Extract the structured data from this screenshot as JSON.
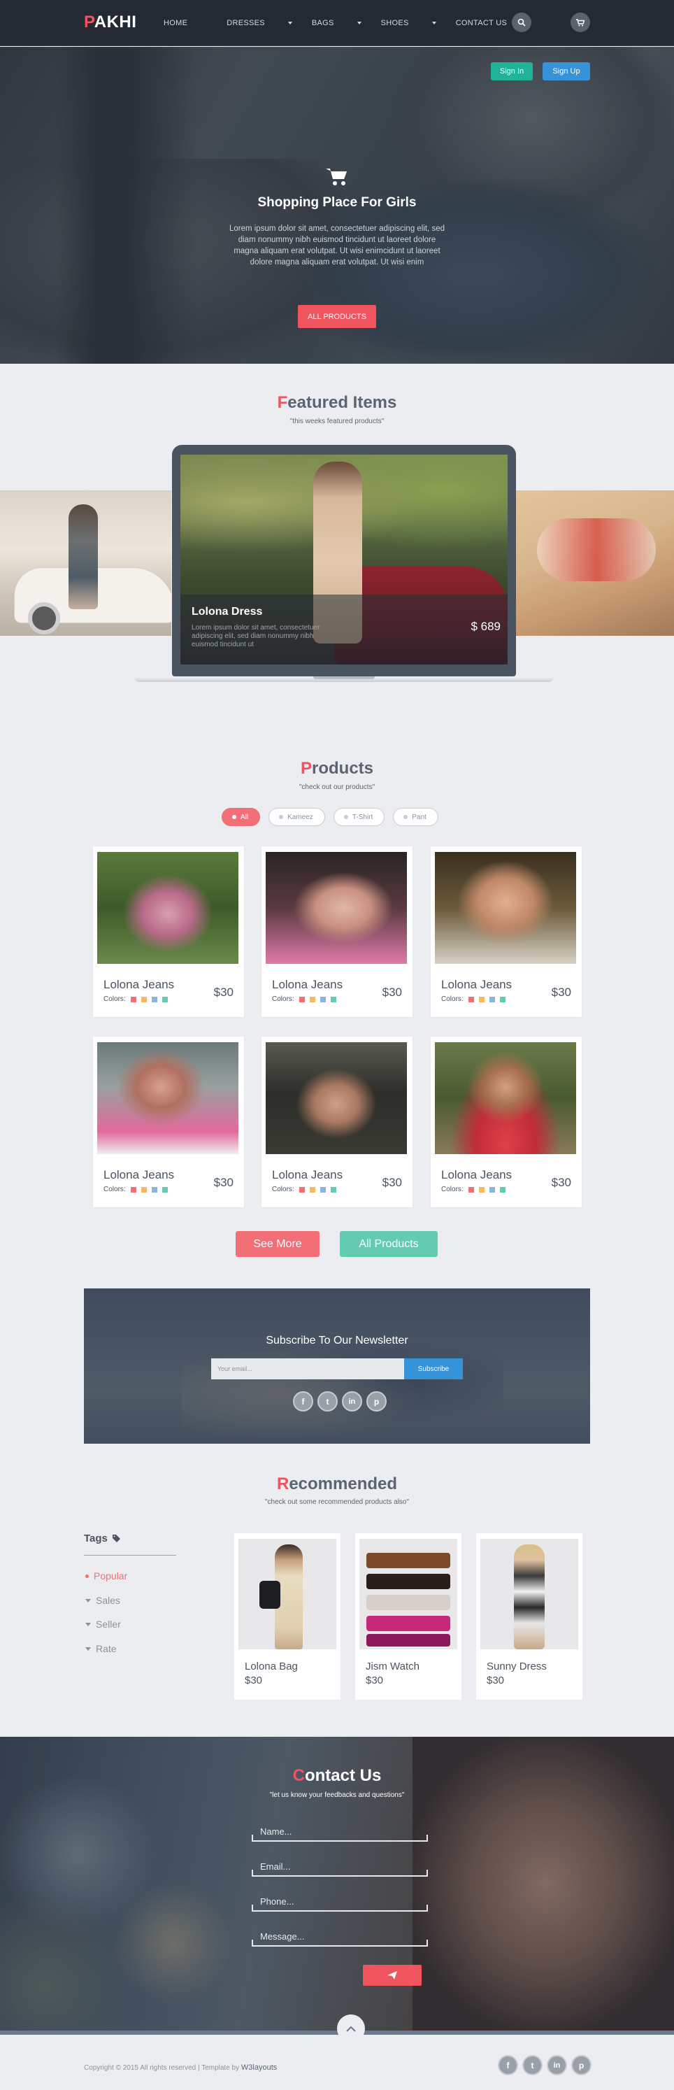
{
  "nav": {
    "logo_first": "P",
    "logo_rest": "AKHI",
    "menu": [
      "HOME",
      "DRESSES",
      "BAGS",
      "SHOES",
      "CONTACT US"
    ],
    "icons": [
      "search-icon",
      "cart-icon"
    ]
  },
  "hero": {
    "sign_in": "Sign In",
    "sign_up": "Sign Up",
    "title": "Shopping Place For Girls",
    "text": "Lorem ipsum dolor sit amet, consectetuer adipiscing elit, sed diam nonummy nibh euismod tincidunt ut laoreet dolore magna aliquam erat volutpat. Ut wisi enimcidunt ut laoreet dolore magna aliquam erat volutpat. Ut wisi enim",
    "button": "ALL PRODUCTS"
  },
  "featured": {
    "title_first": "F",
    "title_rest": "eatured Items",
    "subtitle": "\"this weeks featured products\"",
    "item_title": "Lolona Dress",
    "item_text": "Lorem ipsum dolor sit amet, consectetuer adipiscing elit, sed diam nonummy nibh euismod tincidunt ut",
    "item_price": "$ 689"
  },
  "products": {
    "title_first": "P",
    "title_rest": "roducts",
    "subtitle": "\"check out our products\"",
    "filters": [
      "All",
      "Kameez",
      "T-Shirt",
      "Pant"
    ],
    "colors_label": "Colors:",
    "swatches": [
      "#f36f78",
      "#f7b95c",
      "#8bb3e0",
      "#63ccb0"
    ],
    "items": [
      {
        "name": "Lolona Jeans",
        "price": "$30"
      },
      {
        "name": "Lolona Jeans",
        "price": "$30"
      },
      {
        "name": "Lolona Jeans",
        "price": "$30"
      },
      {
        "name": "Lolona Jeans",
        "price": "$30"
      },
      {
        "name": "Lolona Jeans",
        "price": "$30"
      },
      {
        "name": "Lolona Jeans",
        "price": "$30"
      }
    ],
    "see_more": "See More",
    "all_products": "All Products"
  },
  "newsletter": {
    "title": "Subscribe To Our Newsletter",
    "placeholder": "Your email...",
    "button": "Subscribe",
    "social": [
      "f",
      "t",
      "in",
      "p"
    ]
  },
  "recommended": {
    "title_first": "R",
    "title_rest": "ecommended",
    "subtitle": "\"check out some recommended products also\"",
    "tags_title": "Tags",
    "tags": [
      "Popular",
      "Sales",
      "Seller",
      "Rate"
    ],
    "items": [
      {
        "name": "Lolona Bag",
        "price": "$30"
      },
      {
        "name": "Jism Watch",
        "price": "$30"
      },
      {
        "name": "Sunny Dress",
        "price": "$30"
      }
    ]
  },
  "contact": {
    "title_first": "C",
    "title_rest": "ontact Us",
    "subtitle": "\"let us know your feedbacks and questions\"",
    "fields": [
      "Name...",
      "Email...",
      "Phone...",
      "Message..."
    ]
  },
  "footer": {
    "copyright": "Copyright © 2015 All rights reserved | Template by ",
    "link": "W3layouts",
    "social": [
      "f",
      "t",
      "in",
      "p"
    ]
  },
  "colors": {
    "accent": "#f0545e",
    "teal": "#1fb49a",
    "blue": "#3793d8",
    "dark": "#232a33"
  }
}
